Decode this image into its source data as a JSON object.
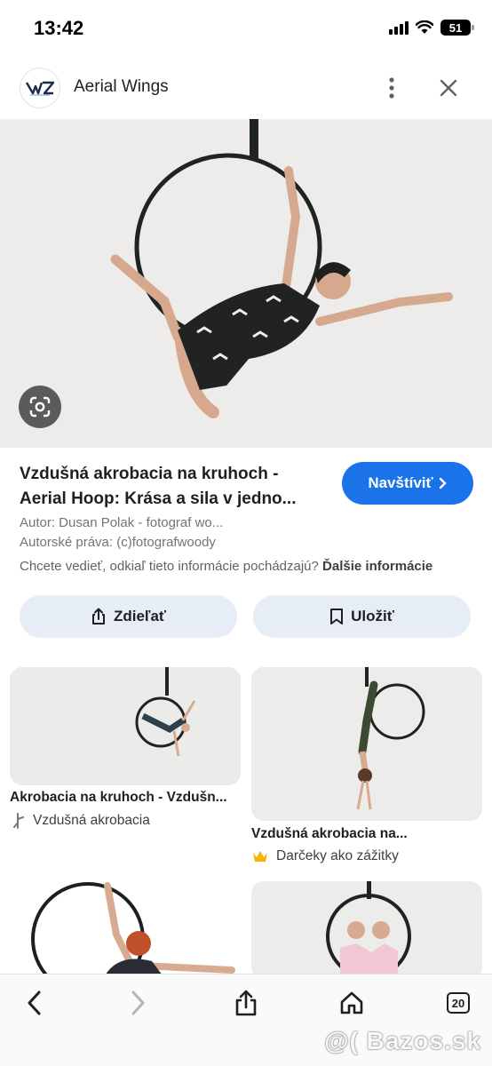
{
  "status_bar": {
    "time": "13:42",
    "battery": "51"
  },
  "header": {
    "logo_text": "EWZ",
    "site_name": "Aerial Wings"
  },
  "result": {
    "title_line1": "Vzdušná akrobacia na kruhoch -",
    "title_line2": "Aerial Hoop: Krása a sila v jedno...",
    "visit_label": "Navštíviť",
    "author": "Autor: Dusan Polak - fotograf wo...",
    "copyright": "Autorské práva: (c)fotografwoody",
    "source_question": "Chcete vedieť, odkiaľ tieto informácie pochádzajú?",
    "source_link": "Ďalšie informácie",
    "share_label": "Zdieľať",
    "save_label": "Uložiť"
  },
  "grid": [
    {
      "title": "Akrobacia na kruhoch - Vzdušn...",
      "source": "Vzdušná akrobacia"
    },
    {
      "title": "Vzdušná akrobacia na...",
      "source": "Darčeky ako zážitky"
    }
  ],
  "bottom_bar": {
    "tabs_count": "20"
  },
  "watermark": "@( Bazos.sk",
  "colors": {
    "accent": "#1a73e8",
    "button_bg": "#e6edf7"
  }
}
